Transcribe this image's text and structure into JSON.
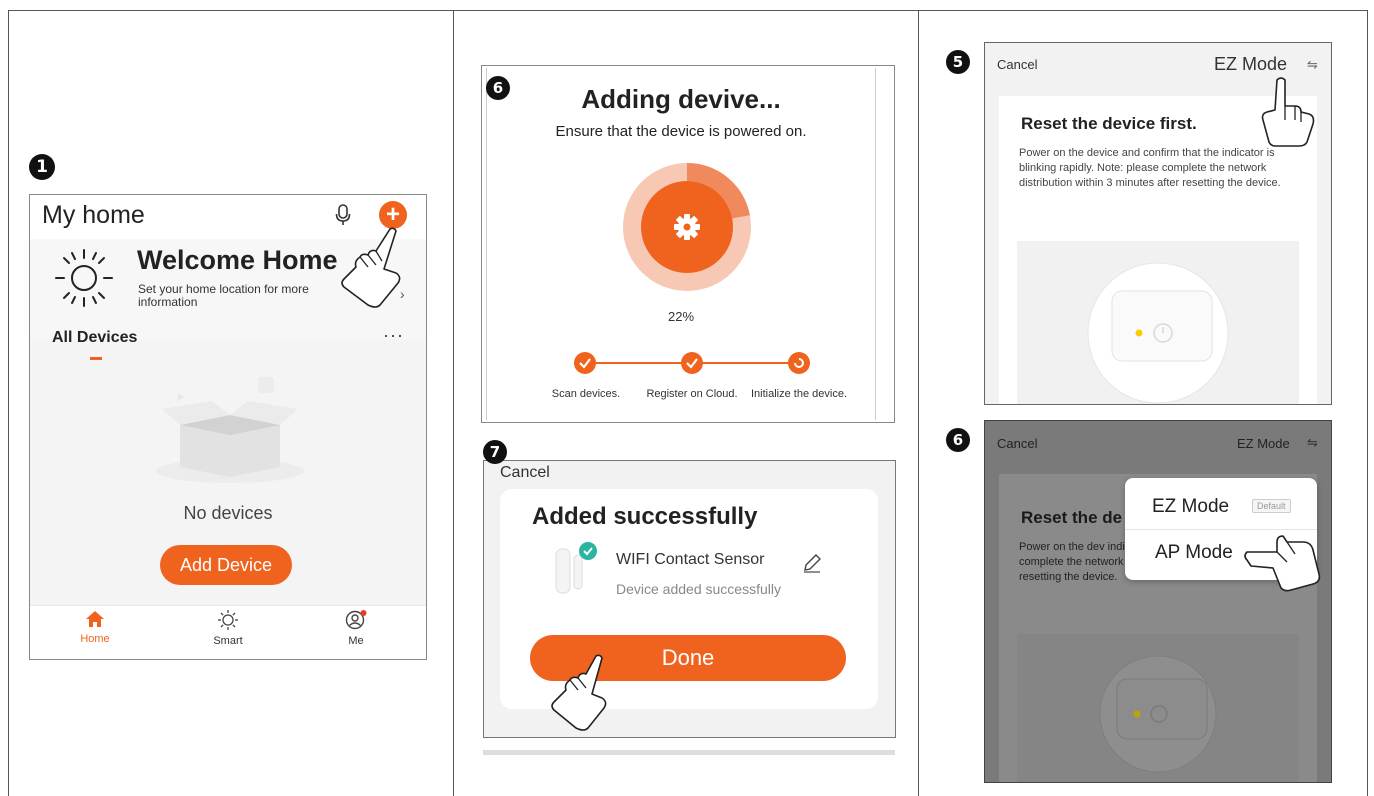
{
  "badges": {
    "one": "1",
    "six_top": "6",
    "seven": "7",
    "five": "5",
    "six_bottom": "6"
  },
  "panel_home": {
    "title": "My home",
    "welcome_title": "Welcome Home",
    "welcome_subtitle": "Set your home location for more information",
    "section_label": "All Devices",
    "more_label": "···",
    "empty_text": "No devices",
    "add_button": "Add Device",
    "tabs": [
      {
        "label": "Home",
        "icon": "home-icon"
      },
      {
        "label": "Smart",
        "icon": "sun-icon"
      },
      {
        "label": "Me",
        "icon": "profile-icon"
      }
    ]
  },
  "panel_adding": {
    "title": "Adding devive...",
    "subtitle": "Ensure that the device is powered on.",
    "progress_text": "22%",
    "progress": 0.22,
    "steps": [
      {
        "label": "Scan devices.",
        "done": true
      },
      {
        "label": "Register on Cloud.",
        "done": true
      },
      {
        "label": "Initialize the device.",
        "done": false
      }
    ]
  },
  "panel_added": {
    "cancel": "Cancel",
    "title": "Added successfully",
    "device_name": "WIFI Contact Sensor",
    "device_status": "Device added successfully",
    "done_button": "Done"
  },
  "panel_reset": {
    "cancel": "Cancel",
    "mode": "EZ Mode",
    "title": "Reset the device first.",
    "description": "Power on the device and confirm that the indicator is blinking rapidly. Note: please complete the network distribution within 3 minutes after resetting the device."
  },
  "panel_mode_menu": {
    "cancel": "Cancel",
    "mode": "EZ Mode",
    "title": "Reset the de",
    "description": "Power on the dev indicator is blinki Note: please complete the network distribution within 3 minutes after resetting the device.",
    "options": [
      {
        "label": "EZ Mode",
        "tag": "Default"
      },
      {
        "label": "AP Mode",
        "tag": ""
      }
    ]
  },
  "colors": {
    "accent": "#f0631f",
    "step_line": "#f0631f"
  }
}
